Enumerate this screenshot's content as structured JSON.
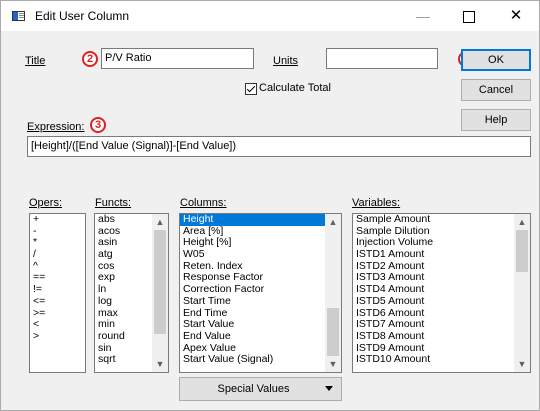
{
  "window": {
    "title": "Edit User Column"
  },
  "titlebar": {
    "minimize": "—",
    "close": "✕"
  },
  "form": {
    "title_label": "Title",
    "title_value": "P/V Ratio",
    "units_label": "Units",
    "units_value": "",
    "calc_total_label": "Calculate Total",
    "calc_total_checked": true,
    "expression_label": "Expression:",
    "expression_value": "[Height]/([End Value (Signal)]-[End Value])"
  },
  "buttons": {
    "ok": "OK",
    "cancel": "Cancel",
    "help": "Help",
    "special_values": "Special Values"
  },
  "markers": {
    "m2": "2",
    "m3": "3",
    "m4": "4"
  },
  "lists": {
    "opers_label": "Opers:",
    "opers": [
      "+",
      "-",
      "*",
      "/",
      "^",
      "==",
      "!=",
      "<=",
      ">=",
      "<",
      ">"
    ],
    "functs_label": "Functs:",
    "functs": [
      "abs",
      "acos",
      "asin",
      "atg",
      "cos",
      "exp",
      "ln",
      "log",
      "max",
      "min",
      "round",
      "sin",
      "sqrt"
    ],
    "columns_label": "Columns:",
    "columns": [
      "Height",
      "Area [%]",
      "Height [%]",
      "W05",
      "Reten. Index",
      "Response Factor",
      "Correction Factor",
      "Start Time",
      "End Time",
      "Start Value",
      "End Value",
      "Apex Value",
      "Start Value (Signal)"
    ],
    "columns_selected": "Height",
    "variables_label": "Variables:",
    "variables": [
      "Sample Amount",
      "Sample Dilution",
      "Injection Volume",
      "ISTD1 Amount",
      "ISTD2 Amount",
      "ISTD3 Amount",
      "ISTD4 Amount",
      "ISTD5 Amount",
      "ISTD6 Amount",
      "ISTD7 Amount",
      "ISTD8 Amount",
      "ISTD9 Amount",
      "ISTD10 Amount"
    ]
  },
  "icons": {
    "scroll_up": "scroll-up-arrow-icon",
    "scroll_down": "scroll-down-arrow-icon",
    "dropdown": "dropdown-arrow-icon",
    "app": "app-icon"
  },
  "colors": {
    "selection": "#0078d7",
    "marker": "#e02020",
    "default_button_border": "#0078d7"
  }
}
